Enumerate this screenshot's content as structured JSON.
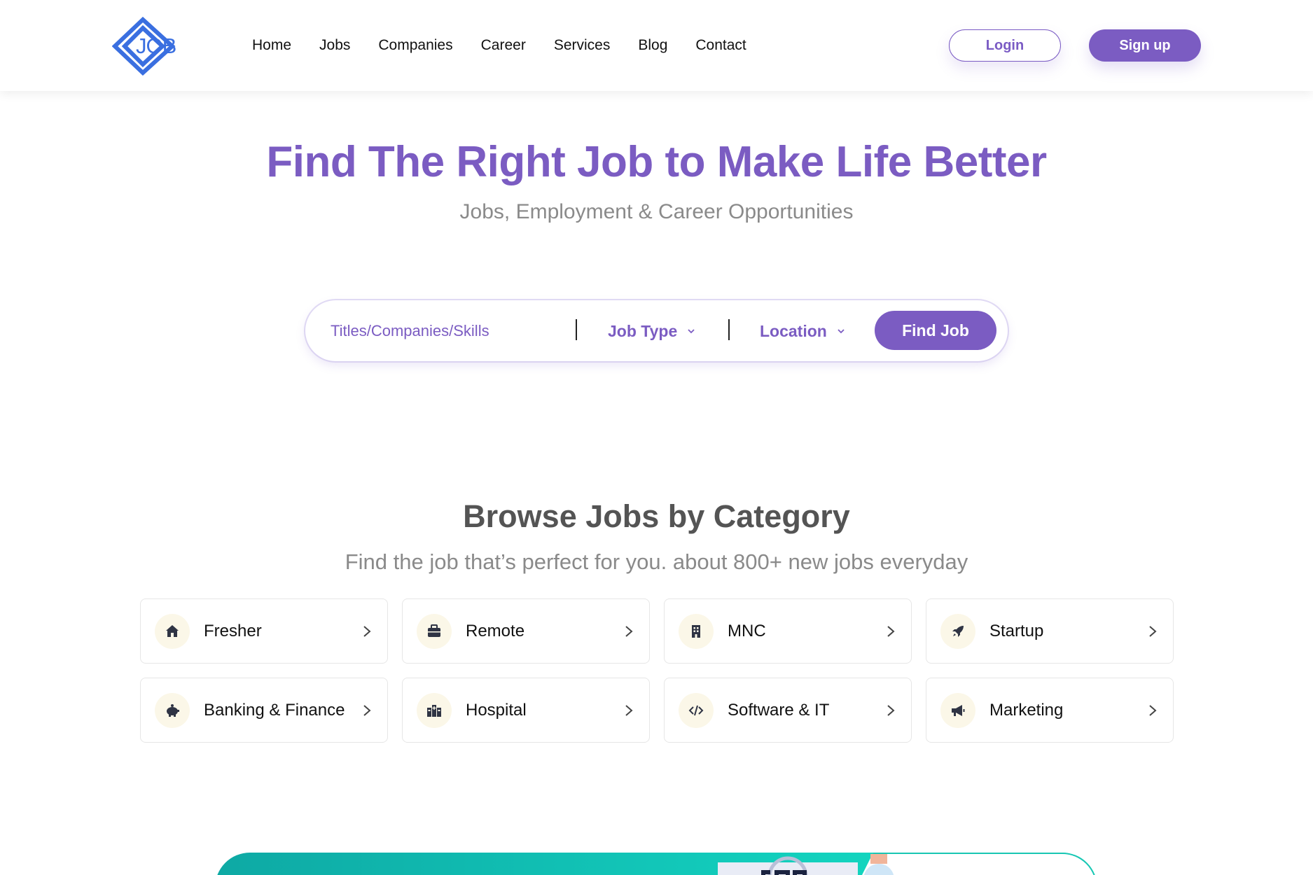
{
  "header": {
    "logo_text": "JOB",
    "nav": [
      "Home",
      "Jobs",
      "Companies",
      "Career",
      "Services",
      "Blog",
      "Contact"
    ],
    "login_label": "Login",
    "signup_label": "Sign up"
  },
  "hero": {
    "title": "Find The Right Job to Make Life Better",
    "subtitle": "Jobs, Employment & Career Opportunities"
  },
  "search": {
    "placeholder": "Titles/Companies/Skills",
    "job_type_label": "Job Type",
    "location_label": "Location",
    "button_label": "Find Job"
  },
  "categories": {
    "title": "Browse Jobs by Category",
    "subtitle": "Find the job that’s perfect for you. about 800+ new jobs everyday",
    "items": [
      {
        "label": "Fresher",
        "icon": "home-icon"
      },
      {
        "label": "Remote",
        "icon": "briefcase-icon"
      },
      {
        "label": "MNC",
        "icon": "building-icon"
      },
      {
        "label": "Startup",
        "icon": "rocket-icon"
      },
      {
        "label": "Banking & Finance",
        "icon": "piggy-bank-icon"
      },
      {
        "label": "Hospital",
        "icon": "hospital-icon"
      },
      {
        "label": "Software & IT",
        "icon": "code-icon"
      },
      {
        "label": "Marketing",
        "icon": "megaphone-icon"
      }
    ]
  },
  "colors": {
    "brand": "#7b5cc2",
    "logo": "#3a6fe0",
    "banner_start": "#0ea9a4",
    "banner_end": "#14e3c6"
  }
}
